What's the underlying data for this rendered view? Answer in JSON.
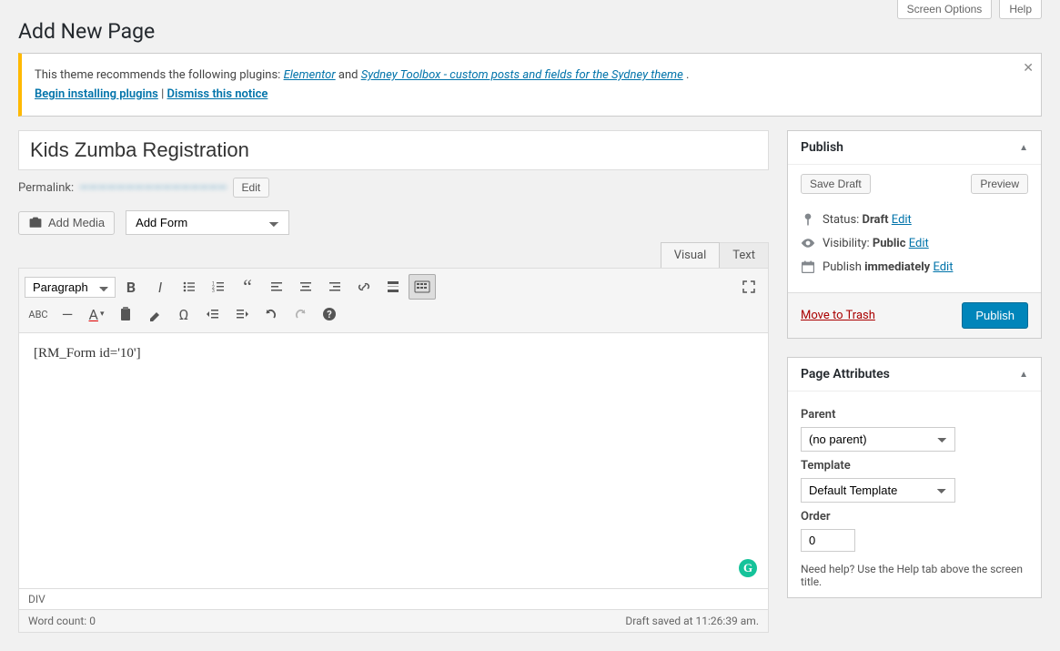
{
  "top": {
    "screen_options": "Screen Options",
    "help": "Help"
  },
  "heading": "Add New Page",
  "notice": {
    "prefix": "This theme recommends the following plugins: ",
    "plugin1": "Elementor",
    "sep": " and ",
    "plugin2": "Sydney Toolbox - custom posts and fields for the Sydney theme",
    "period": ".",
    "install": "Begin installing plugins",
    "pipe": " | ",
    "dismiss": "Dismiss this notice"
  },
  "title_value": "Kids Zumba Registration",
  "permalink": {
    "label": "Permalink:",
    "url": "————————————————",
    "edit": "Edit"
  },
  "editor": {
    "add_media": "Add Media",
    "add_form": "Add Form",
    "tab_visual": "Visual",
    "tab_text": "Text",
    "paragraph": "Paragraph",
    "content": "[RM_Form id='10']",
    "path": "DIV",
    "word_count_label": "Word count: ",
    "word_count": "0",
    "saved": "Draft saved at 11:26:39 am."
  },
  "publish": {
    "title": "Publish",
    "save_draft": "Save Draft",
    "preview": "Preview",
    "status_label": "Status: ",
    "status_value": "Draft",
    "visibility_label": "Visibility: ",
    "visibility_value": "Public",
    "schedule_label": "Publish ",
    "schedule_value": "immediately",
    "edit": "Edit",
    "trash": "Move to Trash",
    "publish_btn": "Publish"
  },
  "attrs": {
    "title": "Page Attributes",
    "parent_label": "Parent",
    "parent_value": "(no parent)",
    "template_label": "Template",
    "template_value": "Default Template",
    "order_label": "Order",
    "order_value": "0",
    "help": "Need help? Use the Help tab above the screen title."
  }
}
